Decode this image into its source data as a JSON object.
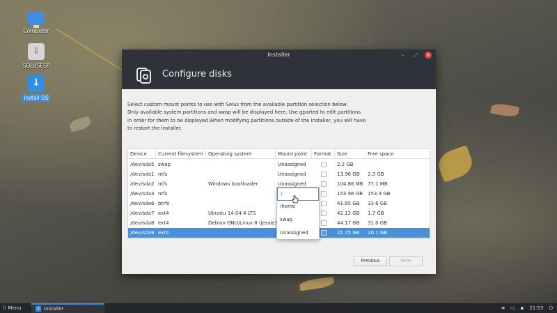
{
  "desktop": {
    "icons": [
      {
        "label": "Computer"
      },
      {
        "label": "SOLUSESP"
      },
      {
        "label": "Install OS"
      }
    ]
  },
  "window": {
    "title": "Installer",
    "header_title": "Configure disks",
    "description": [
      "Select custom mount points to use with Solus from the available partition selection below.",
      "Only available system partitions and swap will be displayed here. Use gparted to edit partitions",
      "in order for them to be displayed.When modifying partitions outside of the installer, you will have",
      "to restart the installer."
    ],
    "table": {
      "columns": [
        "Device",
        "Current filesystem",
        "Operating system",
        "Mount point",
        "Format",
        "Size",
        "Free space"
      ],
      "rows": [
        {
          "device": "/dev/sda5",
          "fs": "swap",
          "os": "",
          "mount": "Unassigned",
          "size": "2.2 GB",
          "free": ""
        },
        {
          "device": "/dev/sda1",
          "fs": "ntfs",
          "os": "",
          "mount": "Unassigned",
          "size": "13.96 GB",
          "free": "2.3 GB"
        },
        {
          "device": "/dev/sda2",
          "fs": "ntfs",
          "os": "Windows bootloader",
          "mount": "Unassigned",
          "size": "104.86 MB",
          "free": "77.1 MB"
        },
        {
          "device": "/dev/sda3",
          "fs": "ntfs",
          "os": "",
          "mount": "",
          "size": "153.96 GB",
          "free": "153.3 GB"
        },
        {
          "device": "/dev/sda6",
          "fs": "btrfs",
          "os": "",
          "mount": "",
          "size": "41.85 GB",
          "free": "33.6 GB"
        },
        {
          "device": "/dev/sda7",
          "fs": "ext4",
          "os": "Ubuntu 14.04.4 LTS",
          "mount": "",
          "size": "42.12 GB",
          "free": "1.7 GB"
        },
        {
          "device": "/dev/sda8",
          "fs": "ext4",
          "os": "Debian GNU/Linux 8 (jessie)",
          "mount": "",
          "size": "44.17 GB",
          "free": "31.0 GB"
        },
        {
          "device": "/dev/sda9",
          "fs": "ext4",
          "os": "",
          "mount": "",
          "size": "21.75 GB",
          "free": "20.1 GB"
        }
      ],
      "selected_row": 7
    },
    "dropdown_options": [
      "/",
      "/home",
      "swap",
      "Unassigned"
    ],
    "buttons": {
      "previous": "Previous",
      "next": "Next"
    }
  },
  "taskbar": {
    "menu_label": "Menu",
    "task_label": "Installer",
    "clock": "21:53"
  },
  "colors": {
    "accent": "#4a90d9",
    "titlebar": "#2f3238",
    "close": "#e0443e"
  }
}
